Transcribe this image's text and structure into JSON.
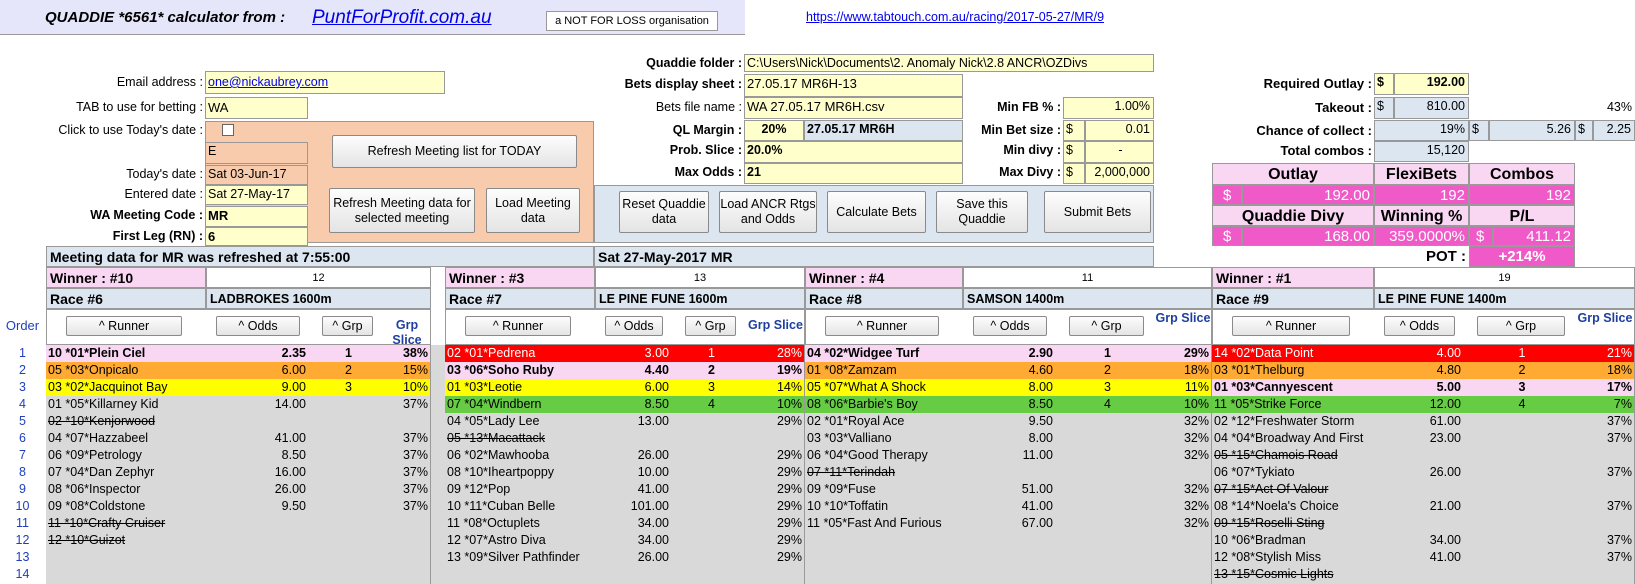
{
  "header": {
    "title": "QUADDIE *6561*  calculator from :",
    "site": "PuntForProfit.com.au",
    "nfl": "a NOT FOR LOSS organisation",
    "url": "https://www.tabtouch.com.au/racing/2017-05-27/MR/9"
  },
  "left": {
    "email_label": "Email address :",
    "email": "one@nickaubrey.com",
    "tab_label": "TAB to use for betting :",
    "tab": "WA",
    "today_click_label": "Click to use Today's date :",
    "e_val": "E",
    "today_label": "Today's date :",
    "today": "Sat 03-Jun-17",
    "entered_label": "Entered date :",
    "entered": "Sat 27-May-17",
    "code_label": "WA Meeting Code :",
    "code": "MR",
    "firstleg_label": "First Leg (RN) :",
    "firstleg": "6"
  },
  "buttons": {
    "refresh_today": "Refresh  Meeting list for TODAY",
    "refresh_meeting": "Refresh Meeting data for selected meeting",
    "load_meeting": "Load Meeting data",
    "reset": "Reset Quaddie data",
    "load_ancr": "Load ANCR Rtgs and Odds",
    "calculate": "Calculate Bets",
    "save": "Save this Quaddie",
    "submit": "Submit Bets"
  },
  "mid": {
    "folder_label": "Quaddie folder :",
    "folder": "C:\\Users\\Nick\\Documents\\2. Anomaly Nick\\2.8 ANCR\\OZDivs",
    "sheet_label": "Bets display sheet :",
    "sheet": "27.05.17 MR6H-13",
    "file_label": "Bets file name :",
    "file": "WA 27.05.17 MR6H.csv",
    "ql_label": "QL Margin :",
    "ql": "20%",
    "ql2": "27.05.17 MR6H",
    "slice_label": "Prob. Slice :",
    "slice": "20.0%",
    "maxodds_label": "Max Odds :",
    "maxodds": "21",
    "minfb_label": "Min FB % :",
    "minfb": "1.00%",
    "minbet_label": "Min Bet size :",
    "minbet_cur": "$",
    "minbet": "0.01",
    "mindivy_label": "Min divy :",
    "mindivy_cur": "$",
    "mindivy": "-",
    "maxdivy_label": "Max Divy :",
    "maxdivy_cur": "$",
    "maxdivy": "2,000,000"
  },
  "right": {
    "outlay_label": "Required Outlay :",
    "outlay_cur": "$",
    "outlay": "192.00",
    "takeout_label": "Takeout :",
    "takeout_cur": "$",
    "takeout": "810.00",
    "takeout_pct": "43%",
    "collect_label": "Chance of collect :",
    "collect": "19%",
    "collect_cur": "$",
    "collect_v1": "5.26",
    "collect_cur2": "$",
    "collect_v2": "2.25",
    "combos_label": "Total combos :",
    "combos": "15,120"
  },
  "summary": {
    "h_outlay": "Outlay",
    "h_flexi": "FlexiBets",
    "h_combos": "Combos",
    "outlay_cur": "$",
    "outlay": "192.00",
    "flexi": "192",
    "combos": "192",
    "h_divy": "Quaddie Divy",
    "h_win": "Winning %",
    "h_pl": "P/L",
    "divy_cur": "$",
    "divy": "168.00",
    "win": "359.0000%",
    "pl_cur": "$",
    "pl": "411.12",
    "pot_label": "POT :",
    "pot": "+214%"
  },
  "status": {
    "refreshed": "Meeting data for MR was refreshed at 7:55:00",
    "meeting": "Sat 27-May-2017  MR"
  },
  "grid": {
    "order_label": "Order",
    "runner_btn": "^ Runner",
    "odds_btn": "^ Odds",
    "grp_btn": "^ Grp",
    "grp_slice": "Grp Slice",
    "orders": [
      "1",
      "2",
      "3",
      "4",
      "5",
      "6",
      "7",
      "8",
      "9",
      "10",
      "11",
      "12",
      "13",
      "14"
    ],
    "races": [
      {
        "winner": "Winner : #10",
        "count": "12",
        "race": "Race #6",
        "track": "LADBROKES 1600m",
        "rows": [
          {
            "r": "10 *01*Plein Ciel",
            "o": "2.35",
            "g": "1",
            "s": "38%",
            "c": "#f9d7f3",
            "b": true
          },
          {
            "r": "05 *03*Onpicalo",
            "o": "6.00",
            "g": "2",
            "s": "15%",
            "c": "#ffaa33"
          },
          {
            "r": "03 *02*Jacquinot Bay",
            "o": "9.00",
            "g": "3",
            "s": "10%",
            "c": "#ffff00"
          },
          {
            "r": "01 *05*Killarney Kid",
            "o": "14.00",
            "g": "",
            "s": "37%"
          },
          {
            "r": "02 *10*Kenjorwood",
            "o": "",
            "g": "",
            "s": "",
            "x": true
          },
          {
            "r": "04 *07*Hazzabeel",
            "o": "41.00",
            "g": "",
            "s": "37%"
          },
          {
            "r": "06 *09*Petrology",
            "o": "8.50",
            "g": "",
            "s": "37%"
          },
          {
            "r": "07 *04*Dan Zephyr",
            "o": "16.00",
            "g": "",
            "s": "37%"
          },
          {
            "r": "08 *06*Inspector",
            "o": "26.00",
            "g": "",
            "s": "37%"
          },
          {
            "r": "09 *08*Coldstone",
            "o": "9.50",
            "g": "",
            "s": "37%"
          },
          {
            "r": "11 *10*Crafty Cruiser",
            "o": "",
            "g": "",
            "s": "",
            "x": true
          },
          {
            "r": "12 *10*Guizot",
            "o": "",
            "g": "",
            "s": "",
            "x": true
          }
        ]
      },
      {
        "winner": "Winner : #3",
        "count": "13",
        "race": "Race #7",
        "track": "LE PINE FUNE 1600m",
        "rows": [
          {
            "r": "02 *01*Pedrena",
            "o": "3.00",
            "g": "1",
            "s": "28%",
            "c": "#ff0000",
            "w": true
          },
          {
            "r": "03 *06*Soho Ruby",
            "o": "4.40",
            "g": "2",
            "s": "19%",
            "c": "#f9d7f3",
            "b": true
          },
          {
            "r": "01 *03*Leotie",
            "o": "6.00",
            "g": "3",
            "s": "14%",
            "c": "#ffff00"
          },
          {
            "r": "07 *04*Windbern",
            "o": "8.50",
            "g": "4",
            "s": "10%",
            "c": "#66cc44"
          },
          {
            "r": "04 *05*Lady Lee",
            "o": "13.00",
            "g": "",
            "s": "29%"
          },
          {
            "r": "05 *13*Macattack",
            "o": "",
            "g": "",
            "s": "",
            "x": true
          },
          {
            "r": "06 *02*Mawhooba",
            "o": "26.00",
            "g": "",
            "s": "29%"
          },
          {
            "r": "08 *10*Iheartpoppy",
            "o": "10.00",
            "g": "",
            "s": "29%"
          },
          {
            "r": "09 *12*Pop",
            "o": "41.00",
            "g": "",
            "s": "29%"
          },
          {
            "r": "10 *11*Cuban Belle",
            "o": "101.00",
            "g": "",
            "s": "29%"
          },
          {
            "r": "11 *08*Octuplets",
            "o": "34.00",
            "g": "",
            "s": "29%"
          },
          {
            "r": "12 *07*Astro Diva",
            "o": "34.00",
            "g": "",
            "s": "29%"
          },
          {
            "r": "13 *09*Silver Pathfinder",
            "o": "26.00",
            "g": "",
            "s": "29%"
          }
        ]
      },
      {
        "winner": "Winner : #4",
        "count": "11",
        "race": "Race #8",
        "track": "SAMSON 1400m",
        "rows": [
          {
            "r": "04 *02*Widgee Turf",
            "o": "2.90",
            "g": "1",
            "s": "29%",
            "c": "#f9d7f3",
            "b": true
          },
          {
            "r": "01 *08*Zamzam",
            "o": "4.60",
            "g": "2",
            "s": "18%",
            "c": "#ffaa33"
          },
          {
            "r": "05 *07*What A Shock",
            "o": "8.00",
            "g": "3",
            "s": "11%",
            "c": "#ffff00"
          },
          {
            "r": "08 *06*Barbie's Boy",
            "o": "8.50",
            "g": "4",
            "s": "10%",
            "c": "#66cc44"
          },
          {
            "r": "02 *01*Royal Ace",
            "o": "9.50",
            "g": "",
            "s": "32%"
          },
          {
            "r": "03 *03*Valliano",
            "o": "8.00",
            "g": "",
            "s": "32%"
          },
          {
            "r": "06 *04*Good Therapy",
            "o": "11.00",
            "g": "",
            "s": "32%"
          },
          {
            "r": "07 *11*Terindah",
            "o": "",
            "g": "",
            "s": "",
            "x": true
          },
          {
            "r": "09 *09*Fuse",
            "o": "51.00",
            "g": "",
            "s": "32%"
          },
          {
            "r": "10 *10*Toffatin",
            "o": "41.00",
            "g": "",
            "s": "32%"
          },
          {
            "r": "11 *05*Fast And Furious",
            "o": "67.00",
            "g": "",
            "s": "32%"
          }
        ]
      },
      {
        "winner": "Winner : #1",
        "count": "19",
        "race": "Race #9",
        "track": "LE PINE FUNE 1400m",
        "rows": [
          {
            "r": "14 *02*Data Point",
            "o": "4.00",
            "g": "1",
            "s": "21%",
            "c": "#ff0000",
            "w": true
          },
          {
            "r": "03 *01*Thelburg",
            "o": "4.80",
            "g": "2",
            "s": "18%",
            "c": "#ffaa33"
          },
          {
            "r": "01 *03*Cannyescent",
            "o": "5.00",
            "g": "3",
            "s": "17%",
            "c": "#f9d7f3",
            "b": true
          },
          {
            "r": "11 *05*Strike Force",
            "o": "12.00",
            "g": "4",
            "s": "7%",
            "c": "#66cc44"
          },
          {
            "r": "02 *12*Freshwater Storm",
            "o": "61.00",
            "g": "",
            "s": "37%"
          },
          {
            "r": "04 *04*Broadway And First",
            "o": "23.00",
            "g": "",
            "s": "37%"
          },
          {
            "r": "05 *15*Chamois Road",
            "o": "",
            "g": "",
            "s": "",
            "x": true
          },
          {
            "r": "06 *07*Tykiato",
            "o": "26.00",
            "g": "",
            "s": "37%"
          },
          {
            "r": "07 *15*Act Of Valour",
            "o": "",
            "g": "",
            "s": "",
            "x": true
          },
          {
            "r": "08 *14*Noela's Choice",
            "o": "21.00",
            "g": "",
            "s": "37%"
          },
          {
            "r": "09 *15*Roselli Sting",
            "o": "",
            "g": "",
            "s": "",
            "x": true
          },
          {
            "r": "10 *06*Bradman",
            "o": "34.00",
            "g": "",
            "s": "37%"
          },
          {
            "r": "12 *08*Stylish Miss",
            "o": "41.00",
            "g": "",
            "s": "37%"
          },
          {
            "r": "13 *15*Cosmic Lights",
            "o": "",
            "g": "",
            "s": "",
            "x": true
          }
        ]
      }
    ]
  }
}
